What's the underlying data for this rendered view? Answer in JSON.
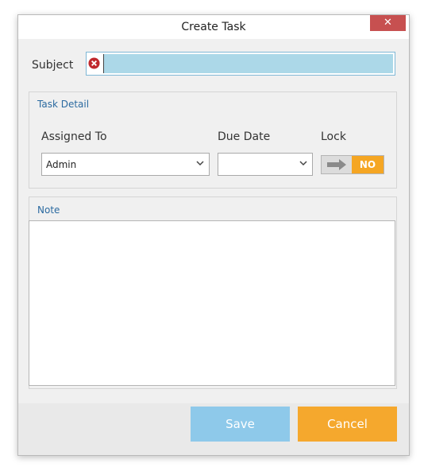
{
  "window": {
    "title": "Create Task",
    "close_glyph": "✕"
  },
  "subject": {
    "label": "Subject",
    "value": "",
    "error_icon": "error-circle-icon"
  },
  "task_detail": {
    "title": "Task Detail",
    "assigned_to": {
      "label": "Assigned To",
      "value": "Admin"
    },
    "due_date": {
      "label": "Due Date",
      "value": ""
    },
    "lock": {
      "label": "Lock",
      "state": "NO"
    }
  },
  "note": {
    "title": "Note",
    "value": ""
  },
  "buttons": {
    "save": "Save",
    "cancel": "Cancel"
  },
  "colors": {
    "accent_blue": "#8ec9ea",
    "accent_orange": "#f5a623",
    "close_red": "#c75050",
    "error_red": "#c0282d"
  }
}
